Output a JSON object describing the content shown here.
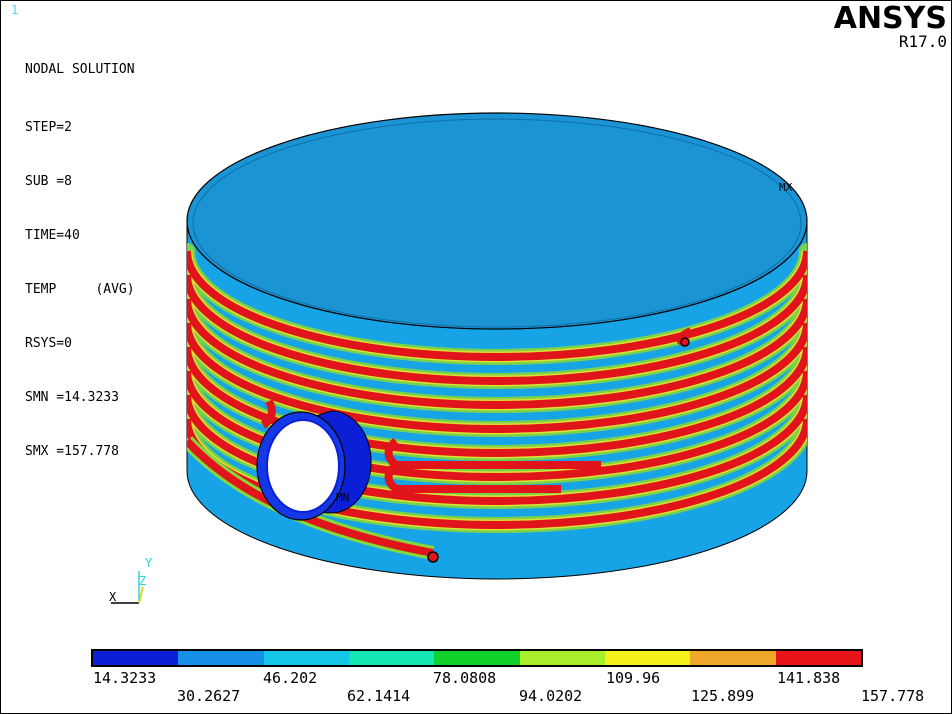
{
  "window_number": "1",
  "info": {
    "title": "NODAL SOLUTION",
    "lines": [
      "STEP=2",
      "SUB =8",
      "TIME=40",
      "TEMP     (AVG)",
      "RSYS=0",
      "SMN =14.3233",
      "SMX =157.778"
    ]
  },
  "logo": {
    "brand": "ANSYS",
    "version": "R17.0"
  },
  "markers": {
    "max": "MX",
    "min": "MN"
  },
  "triad": {
    "x": "X",
    "y": "Y",
    "z": "Z"
  },
  "legend": {
    "colors": [
      "#0a1fd6",
      "#1590e6",
      "#16c6e8",
      "#16e6b4",
      "#10d22a",
      "#a8ee2a",
      "#f5ef1a",
      "#f0a82a",
      "#e8141a"
    ],
    "top_labels": [
      "14.3233",
      "46.202",
      "78.0808",
      "109.96",
      "141.838"
    ],
    "bottom_labels": [
      "30.2627",
      "62.1414",
      "94.0202",
      "125.899",
      "157.778"
    ]
  },
  "colors": {
    "cylinder_body": "#17a4e6",
    "cylinder_top": "#1b94d4",
    "pipe_hot": "#e0141a",
    "pipe_halo": "#7ad23a",
    "port_blue": "#0a1fd6"
  }
}
